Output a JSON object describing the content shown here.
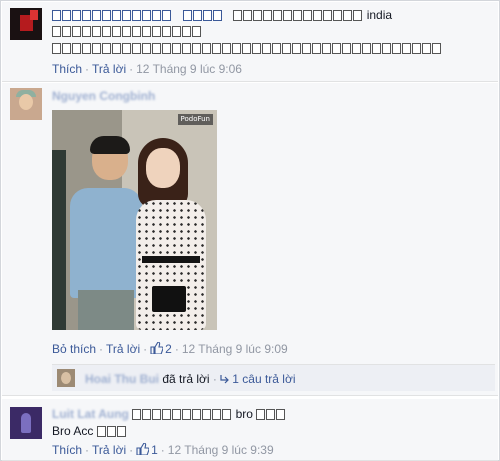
{
  "comments": [
    {
      "author_name": "",
      "line1_suffix": "india",
      "actions": {
        "like": "Thích",
        "reply": "Trả lời",
        "time": "12 Tháng 9 lúc 9:06"
      }
    },
    {
      "author_name": "Nguyen Congbinh",
      "photo_badge": "PodoFun",
      "actions": {
        "unlike": "Bỏ thích",
        "reply": "Trả lời",
        "likes": "2",
        "time": "12 Tháng 9 lúc 9:09"
      },
      "reply_summary": {
        "replier": "Hoai Thu Bui",
        "text": "đã trả lời",
        "dot": "·",
        "count_label": "1 câu trả lời"
      }
    },
    {
      "author_name": "Luit Lat Aung",
      "line1_suffix": "bro",
      "line2_prefix": "Bro Acc",
      "actions": {
        "like": "Thích",
        "reply": "Trả lời",
        "likes": "1",
        "time": "12 Tháng 9 lúc 9:39"
      }
    }
  ],
  "separator": "·",
  "colors": {
    "link": "#3b5998",
    "meta_grey": "#9197a3",
    "background": "#f6f7f9"
  },
  "icons": [
    "like-thumb-icon",
    "reply-arrow-icon"
  ]
}
